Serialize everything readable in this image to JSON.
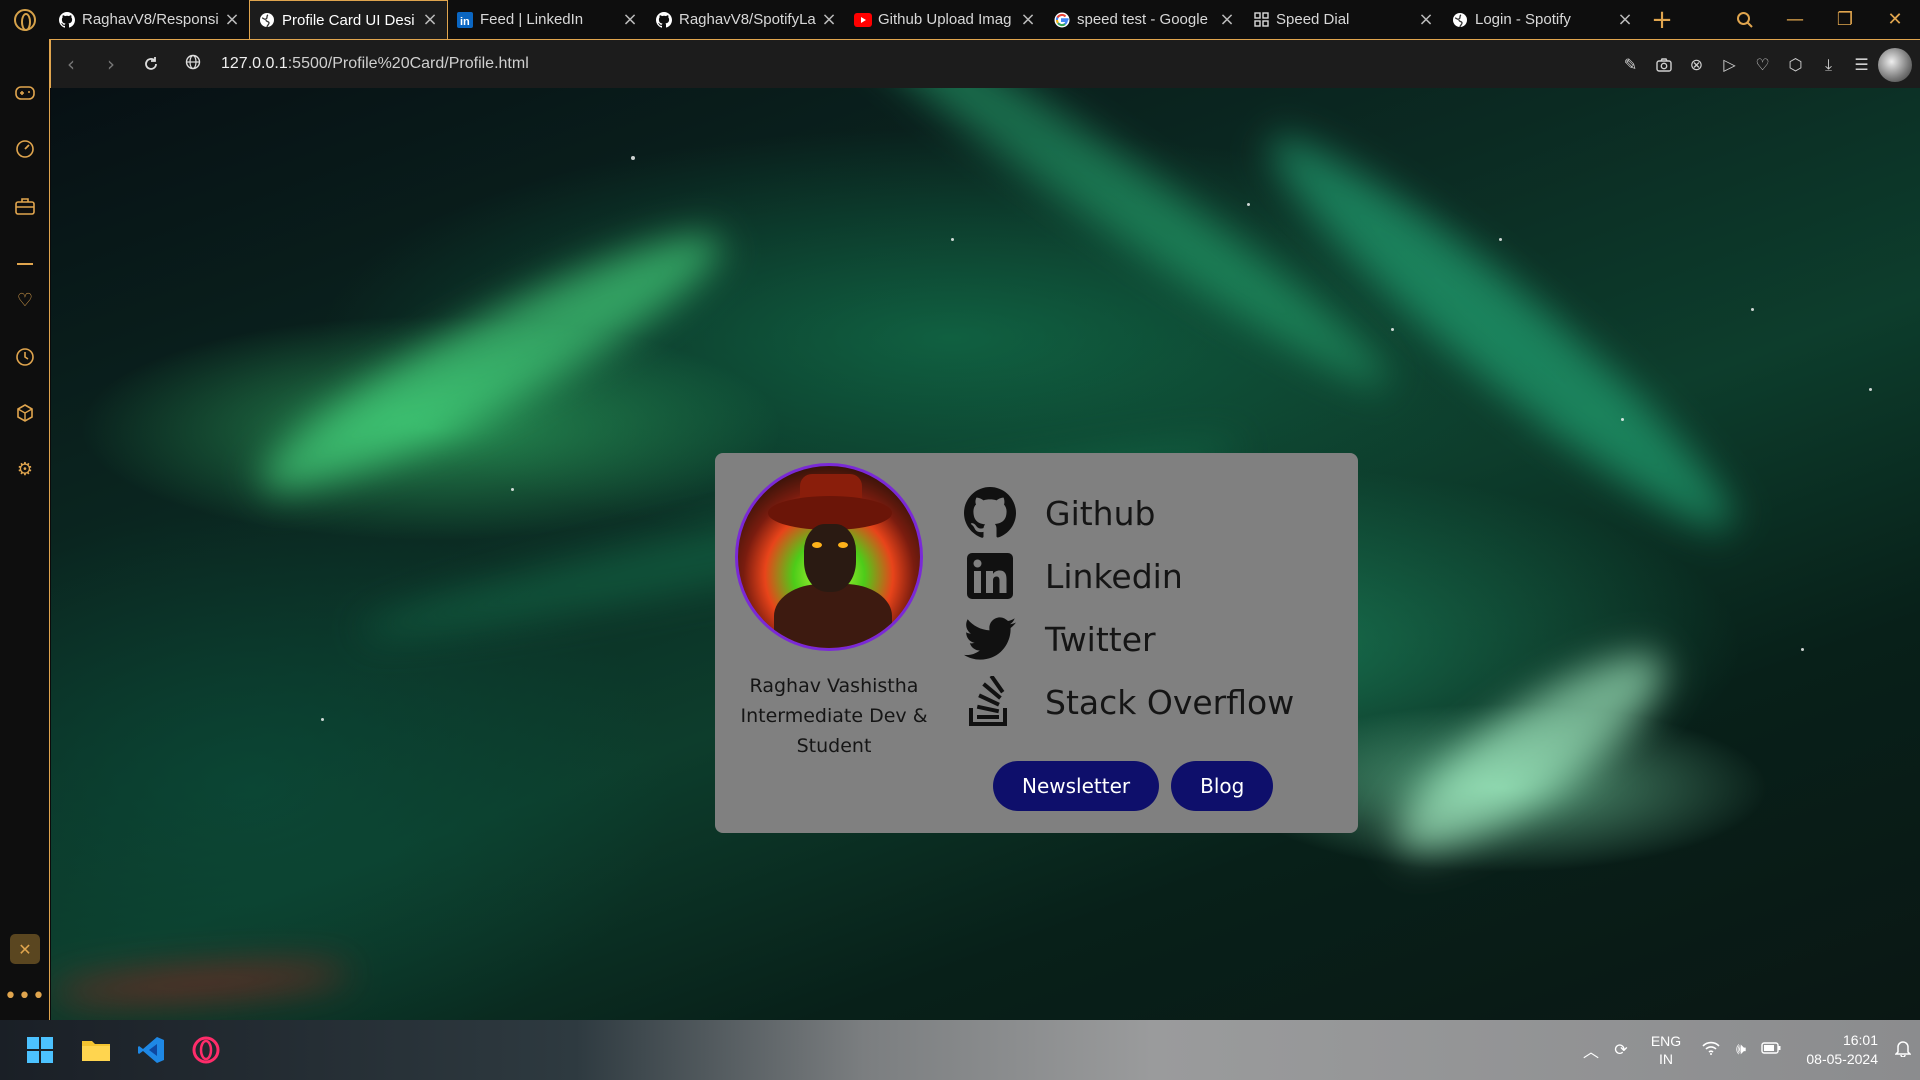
{
  "browser": {
    "tabs": [
      {
        "title": "RaghavV8/Responsi",
        "icon": "github-icon"
      },
      {
        "title": "Profile Card UI Desi",
        "icon": "globe-icon",
        "active": true
      },
      {
        "title": "Feed | LinkedIn",
        "icon": "linkedin-icon"
      },
      {
        "title": "RaghavV8/SpotifyLa",
        "icon": "github-icon"
      },
      {
        "title": "Github Upload Imag",
        "icon": "youtube-icon"
      },
      {
        "title": "speed test - Google",
        "icon": "google-icon"
      },
      {
        "title": "Speed Dial",
        "icon": "speed-dial-icon"
      },
      {
        "title": "Login - Spotify",
        "icon": "globe-icon"
      }
    ],
    "url": {
      "host": "127.0.0.1",
      "rest": ":5500/Profile%20Card/Profile.html"
    },
    "accent_color": "#e0a54e"
  },
  "profile": {
    "name": "Raghav Vashistha",
    "role_line1": "Intermediate Dev &",
    "role_line2": "Student"
  },
  "links": [
    {
      "label": "Github",
      "icon": "github-icon"
    },
    {
      "label": "Linkedin",
      "icon": "linkedin-icon"
    },
    {
      "label": "Twitter",
      "icon": "twitter-icon"
    },
    {
      "label": "Stack Overflow",
      "icon": "stackoverflow-icon"
    }
  ],
  "buttons": {
    "newsletter": "Newsletter",
    "blog": "Blog"
  },
  "colors": {
    "card_bg": "#808080",
    "button_bg": "#0e0f6b",
    "avatar_border": "#7a29d6"
  },
  "taskbar": {
    "lang_line1": "ENG",
    "lang_line2": "IN",
    "time": "16:01",
    "date": "08-05-2024"
  }
}
